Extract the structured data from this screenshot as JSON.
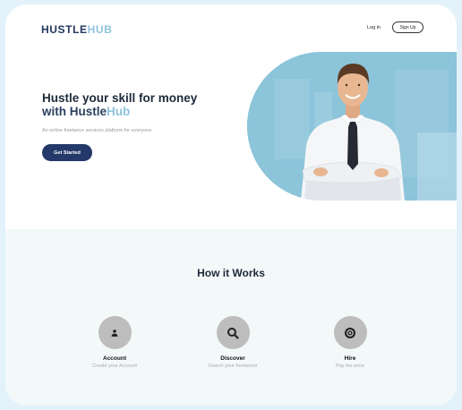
{
  "nav": {
    "logo_part1": "HUSTLE",
    "logo_part2": "HUB",
    "login_label": "Log in",
    "signup_label": "Sign Up"
  },
  "hero": {
    "title_line1": "Hustle your skill for money",
    "title_with": "with ",
    "title_hustle": "Hustle",
    "title_hub": "Hub",
    "subtitle": "An online freelance services platform for everyone",
    "cta_label": "Get Started"
  },
  "how_it_works": {
    "title": "How it Works",
    "steps": [
      {
        "icon": "user-icon",
        "label": "Account",
        "desc": "Create your Account"
      },
      {
        "icon": "search-icon",
        "label": "Discover",
        "desc": "Search your freelancer"
      },
      {
        "icon": "coin-icon",
        "label": "Hire",
        "desc": "Pay the price"
      }
    ]
  },
  "colors": {
    "brand_dark": "#24396a",
    "brand_light": "#8fc3dc",
    "section_bg": "#f3f8f9"
  }
}
